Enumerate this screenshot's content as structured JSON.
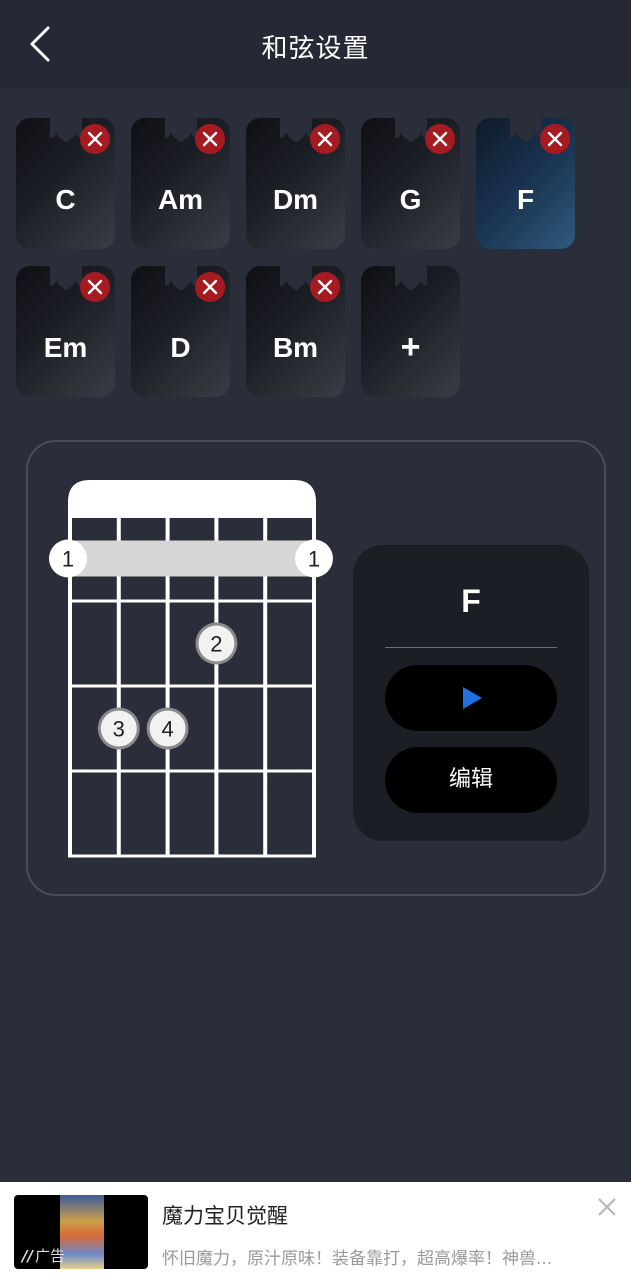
{
  "header": {
    "title": "和弦设置",
    "back_icon": "chevron-left-icon"
  },
  "chords": {
    "items": [
      {
        "name": "C",
        "selected": false,
        "deletable": true
      },
      {
        "name": "Am",
        "selected": false,
        "deletable": true
      },
      {
        "name": "Dm",
        "selected": false,
        "deletable": true
      },
      {
        "name": "G",
        "selected": false,
        "deletable": true
      },
      {
        "name": "F",
        "selected": true,
        "deletable": true
      },
      {
        "name": "Em",
        "selected": false,
        "deletable": true
      },
      {
        "name": "D",
        "selected": false,
        "deletable": true
      },
      {
        "name": "Bm",
        "selected": false,
        "deletable": true
      }
    ],
    "add_label": "+",
    "delete_icon": "close-icon"
  },
  "diagram": {
    "strings": 6,
    "frets": 4,
    "barre": {
      "fret": 1,
      "finger_left": "1",
      "finger_right": "1"
    },
    "dots": [
      {
        "fret": 2,
        "string": 4,
        "finger": "2"
      },
      {
        "fret": 3,
        "string": 2,
        "finger": "3"
      },
      {
        "fret": 3,
        "string": 3,
        "finger": "4"
      }
    ]
  },
  "info_panel": {
    "chord_name": "F",
    "play_icon": "play-icon",
    "edit_label": "编辑",
    "accent_color": "#1e6fe0"
  },
  "ad": {
    "title": "魔力宝贝觉醒",
    "description": "怀旧魔力，原汁原味！装备靠打，超高爆率！神兽...",
    "label": "广告",
    "close_icon": "close-icon"
  }
}
